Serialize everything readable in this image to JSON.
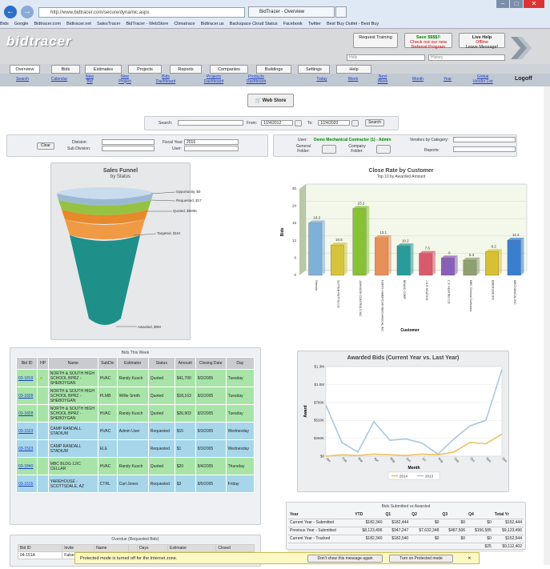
{
  "browser": {
    "url": "http://www.bidtracer.com/secure/dynamic.aspx",
    "tab_title": "BidTracer - Overview",
    "favorites": [
      "Bids",
      "Google",
      "Bidtracer.com",
      "Bidtracer.net",
      "SalesTracer",
      "BidTracer - WebStore",
      "Climatrace",
      "Bidtracer.us",
      "Backspace Cloud Status",
      "Facebook",
      "Twitter",
      "Best Buy Outlet - Best Buy"
    ]
  },
  "header": {
    "logo": "bidtracer",
    "request_training": "Request Training",
    "save_line1": "Save $$$$!!",
    "save_line2": "Check out our new",
    "save_line3": "Referral Program",
    "live_help": "Live Help",
    "live_offline": "Offline",
    "live_leave": "Leave Message!",
    "help_placeholder": "Help",
    "history_placeholder": "History"
  },
  "tabs": [
    "Overview",
    "Bids",
    "Estimates",
    "Projects",
    "Reports",
    "Companies",
    "Buildings",
    "Settings",
    "Help"
  ],
  "subnav": [
    "Search",
    "Calendar",
    "New Bid",
    "New Project",
    "Bids Dashboard",
    "Projects Dashboard",
    "Products Dashboard",
    "Today",
    "Week",
    "Next Week",
    "Month",
    "Year",
    "Global Vendor List"
  ],
  "logoff": "Logoff",
  "webstore": "Web Store",
  "search": {
    "label": "Search:",
    "from_label": "From:",
    "from": "1/24/2012",
    "to_label": "To:",
    "to": "1/24/2020",
    "button": "Search"
  },
  "filters": {
    "clear": "Clear",
    "division": "Division:",
    "subdivision": "Sub Division:",
    "fiscal_year": "Fiscal Year:",
    "fiscal_value": "2016",
    "user": "User:",
    "user_label": "User:",
    "user_value": "Demo Mechanical Contractor (1) - Admin",
    "general_folder": "General Folder:",
    "company_folder": "Company Folder:",
    "vendors": "Vendors by Category:",
    "reports": "Reports:"
  },
  "funnel": {
    "title": "Sales Funnel",
    "subtitle": "by Status",
    "labels": [
      "Opportunity, $0",
      "Requested, $17",
      "Quoted, $580K",
      "Targeted, $1M",
      "Awarded, $0M"
    ]
  },
  "chart_data": [
    {
      "type": "bar",
      "title": "Close Rate by Customer",
      "subtitle": "Top 10 by Awarded Amount",
      "xlabel": "Customer",
      "ylabel": "Bids",
      "ylim": [
        0,
        30
      ],
      "yticks": [
        0,
        6,
        12,
        18,
        24,
        30
      ],
      "categories": [
        "Ofrenda",
        "SUTTER-PETTIS CO",
        "JOHNSON CONTROLS INC",
        "NORTH AMERICAN MECHANICAL INC",
        "BRAND CORP",
        "J & R HEATING",
        "C.F. HEATING CO.",
        "MBC General Contractor",
        "EMERSON INC",
        "MECHANICAL INC"
      ],
      "values": [
        18.2,
        10.5,
        23.2,
        13.1,
        10.2,
        7.6,
        6,
        5.3,
        8.2,
        12.2
      ],
      "colors": [
        "#7fb0d8",
        "#d6c43c",
        "#86c234",
        "#e8905a",
        "#2a9b9b",
        "#d85a6c",
        "#8a5fb8",
        "#8fa070",
        "#d8c034",
        "#3a7ed0"
      ]
    },
    {
      "type": "line",
      "title": "Awarded Bids (Current Year vs. Last Year)",
      "xlabel": "Month",
      "ylabel": "Award",
      "ylim": [
        0,
        1300000
      ],
      "yticks": [
        "$0",
        "$260K",
        "$520K",
        "$780K",
        "$1.0M",
        "$1.3M"
      ],
      "categories": [
        "Jan",
        "Feb",
        "Mar",
        "Apr",
        "May",
        "Jun",
        "Jul",
        "Aug",
        "Sep",
        "Oct",
        "Nov",
        "Dec"
      ],
      "series": [
        {
          "name": "2014",
          "color": "#f0c060",
          "values": [
            0,
            20000,
            10000,
            30000,
            20000,
            10000,
            30000,
            20000,
            60000,
            200000,
            180000,
            320000
          ]
        },
        {
          "name": "2013",
          "color": "#a8c8e0",
          "values": [
            740000,
            200000,
            60000,
            500000,
            230000,
            250000,
            190000,
            30000,
            250000,
            440000,
            520000,
            1260000
          ]
        }
      ]
    }
  ],
  "bids": {
    "title": "Bids This Week",
    "headers": [
      "Bid ID",
      "HP",
      "Name",
      "SubDiv",
      "Estimator",
      "Status",
      "Amount",
      "Closing Date",
      "Day"
    ],
    "rows": [
      {
        "id": "03-1819",
        "hp": "★",
        "name": "NORTH & SOUTH HIGH SCHOOL BPRZ - SHEBOYGAN",
        "sub": "HVAC",
        "est": "Randy Kusch",
        "status": "Quoted",
        "amount": "$41,700",
        "date": "8/2/2005",
        "day": "Tuesday",
        "cls": "rg"
      },
      {
        "id": "03-1828",
        "hp": "",
        "name": "NORTH & SOUTH HIGH SCHOOL BPRZ - SHEBOYGAN",
        "sub": "PLMB",
        "est": "Willie Smith",
        "status": "Quoted",
        "amount": "$18,163",
        "date": "8/2/2005",
        "day": "Tuesday",
        "cls": "rg"
      },
      {
        "id": "03-1828",
        "hp": "",
        "name": "NORTH & SOUTH HIGH SCHOOL BPRZ - SHEBOYGAN",
        "sub": "HVAC",
        "est": "Randy Kusch",
        "status": "Quoted",
        "amount": "$26,903",
        "date": "8/2/2005",
        "day": "Tuesday",
        "cls": "rg"
      },
      {
        "id": "03-1523",
        "hp": "",
        "name": "CAMP RANDALL STADIUM",
        "sub": "HVAC",
        "est": "Admin User",
        "status": "Requested",
        "amount": "$15",
        "date": "8/3/2005",
        "day": "Wednesday",
        "cls": "rb"
      },
      {
        "id": "03-1523",
        "hp": "",
        "name": "CAMP RANDALL STADIUM",
        "sub": "ELE",
        "est": "",
        "status": "Requested",
        "amount": "$1",
        "date": "8/3/2005",
        "day": "Wednesday",
        "cls": "rb"
      },
      {
        "id": "03-1840",
        "hp": "",
        "name": "MBC BLDG 12/C CELLAR",
        "sub": "HVAC",
        "est": "Randy Kusch",
        "status": "Quoted",
        "amount": "$20",
        "date": "8/4/2005",
        "day": "Thursday",
        "cls": "rg"
      },
      {
        "id": "03-1515",
        "hp": "",
        "name": "YAREHOUSE - SCOTTSDALE, AZ",
        "sub": "CTRL",
        "est": "Carl Jones",
        "status": "Requested",
        "amount": "$3",
        "date": "8/5/2005",
        "day": "Friday",
        "cls": "rb"
      }
    ]
  },
  "submitted": {
    "title": "Bids Submitted vs Awarded",
    "headers": [
      "Year",
      "YTD",
      "Q1",
      "Q2",
      "Q3",
      "Q4",
      "Total Yr"
    ],
    "rows": [
      [
        "Current Year - Submitted",
        "$182,340",
        "$182,444",
        "$0",
        "$0",
        "$0",
        "$152,444"
      ],
      [
        "Previous Year - Submitted",
        "$8,123,496",
        "$947,247",
        "$7,632,348",
        "$487,506",
        "$156,585",
        "$9,123,496"
      ],
      [
        "Current Year - Tracked",
        "$182,340",
        "$182,540",
        "$0",
        "$0",
        "$0",
        "$152,544"
      ],
      [
        "",
        "",
        "",
        "",
        "",
        "$25",
        "$9,112,402"
      ]
    ]
  },
  "overdue": {
    "title": "Overdue (Requested Bids)",
    "headers": [
      "Bid ID",
      "Invite",
      "Name",
      "",
      "Days",
      "Estimator",
      "Closed"
    ],
    "row": [
      "04-151A",
      "False",
      "N",
      "",
      "",
      "",
      ""
    ]
  },
  "notify": {
    "text": "Protected mode is turned off for the Internet zone.",
    "dont_show": "Don't show this message again",
    "turn_on": "Turn on Protected mode"
  }
}
